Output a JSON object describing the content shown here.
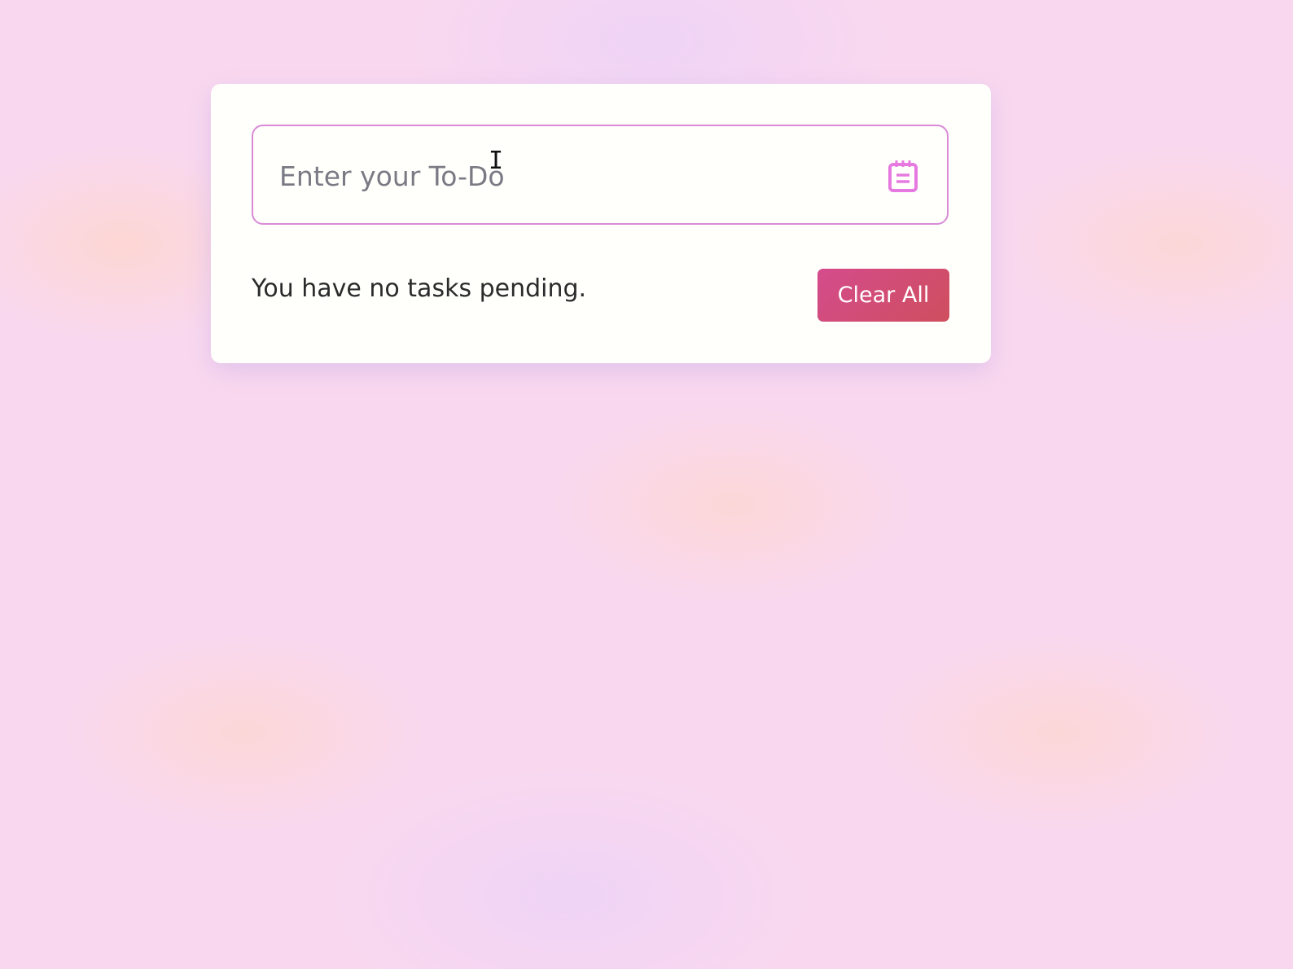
{
  "todo": {
    "input_placeholder": "Enter your To-Do",
    "input_value": "",
    "input_icon": "notepad-icon",
    "status_text": "You have no tasks pending.",
    "clear_all_label": "Clear All"
  },
  "colors": {
    "accent": "#d98bd6",
    "button": "#d14c76"
  }
}
